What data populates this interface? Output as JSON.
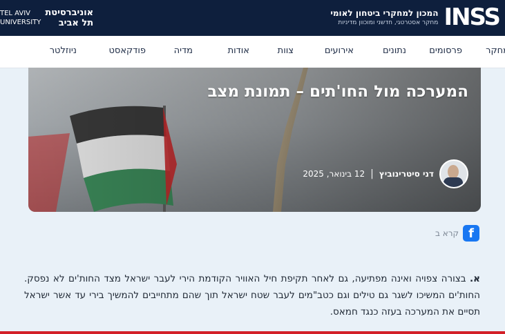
{
  "header": {
    "inss_logo_text": "INSS",
    "inss_name": "המכון למחקרי ביטחון לאומי",
    "inss_subtitle": "מחקר אסטרטגי, חדשני ומוכוון מדיניות",
    "tau_en_line1": "TEL AVIV",
    "tau_en_line2": "UNIVERSITY",
    "tau_he_line1": "אוניברסיטת",
    "tau_he_line2": "תל אביב"
  },
  "nav": {
    "items": [
      "מחקר",
      "פרסומים",
      "נתונים",
      "אירועים",
      "צוות",
      "אודות",
      "מדיה",
      "פודקאסט",
      "ניוזלטר"
    ]
  },
  "article": {
    "title": "המערכה מול החו'תים – תמונת מצב",
    "author": "דני סיטרינוביץ",
    "separator": "|",
    "date": "12 בינואר, 2025"
  },
  "share": {
    "label": "קרא ב",
    "icon": "facebook-icon",
    "icon_glyph": "f"
  },
  "body": {
    "lead_letter": "א.",
    "paragraph": "בצורה צפויה ואינה מפתיעה, גם לאחר תקיפת חיל האוויר הקודמת הירי לעבר ישראל מצד החות'ים לא נפסק. החות'ים המשיכו לשגר גם טילים וגם כטב\"מים לעבר שטח ישראל תוך שהם מתחייבים להמשיך בירי עד אשר ישראל תסיים את המערכה בעזה כנגד חמאס."
  },
  "colors": {
    "header_bg": "#0e1f3d",
    "page_bg": "#e9f1f8",
    "facebook_blue": "#1877f2",
    "flag_red": "#c8282a",
    "flag_green": "#3c8a5a"
  }
}
